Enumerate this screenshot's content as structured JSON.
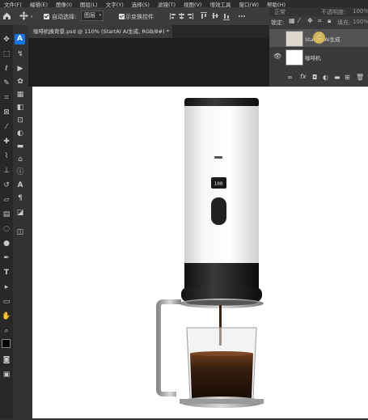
{
  "menu": [
    "文件(F)",
    "编辑(E)",
    "图像(I)",
    "图层(L)",
    "文字(Y)",
    "选择(S)",
    "滤镜(T)",
    "视图(V)",
    "增效工具",
    "窗口(W)",
    "帮助(H)"
  ],
  "options": {
    "auto_select_label": "自动选择:",
    "auto_select_value": "图层",
    "transform_label": "显示变换控件"
  },
  "document_tab": {
    "title": "咖啡机换背景.psd @ 110% (StartAI AI生成, RGB/8#) *",
    "close": "×"
  },
  "layers": {
    "blend_mode": "正常",
    "opacity_label": "不透明度:",
    "opacity_value": "100%",
    "lock_label": "锁定:",
    "fill_label": "填充:",
    "fill_value": "100%",
    "items": [
      {
        "name": "StartAI AI生成",
        "visible": false,
        "selected": true
      },
      {
        "name": "咖啡机",
        "visible": true,
        "selected": false
      }
    ]
  },
  "device_display": "100",
  "colors": {
    "accent": "#1473e6",
    "panel": "#3a3a3a",
    "canvas": "#ffffff"
  }
}
